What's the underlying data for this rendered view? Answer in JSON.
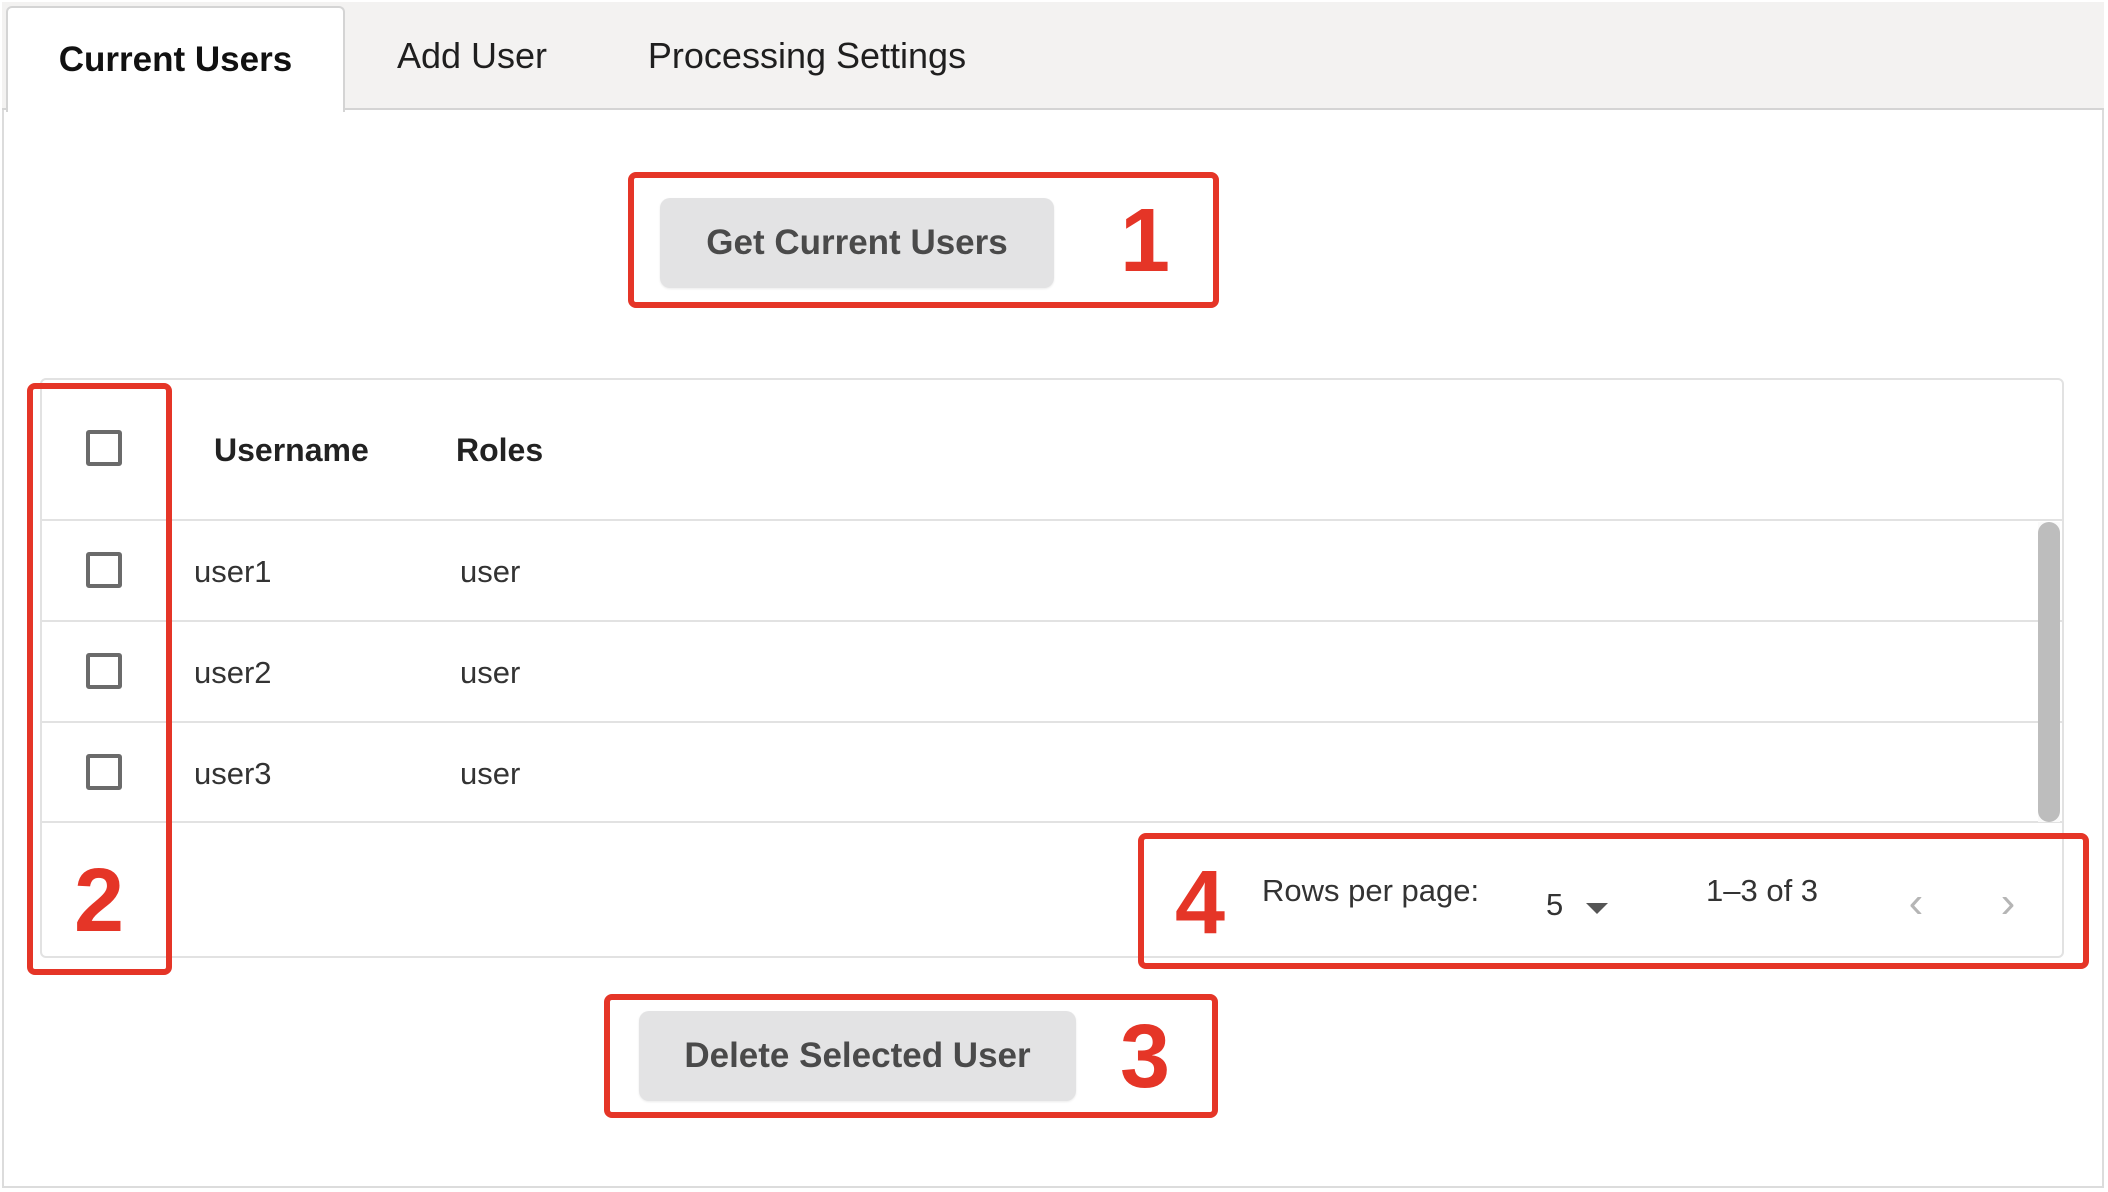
{
  "tabs": [
    {
      "label": "Current Users",
      "active": true
    },
    {
      "label": "Add User",
      "active": false
    },
    {
      "label": "Processing Settings",
      "active": false
    }
  ],
  "actions": {
    "get_users_label": "Get Current Users",
    "delete_label": "Delete Selected User"
  },
  "table": {
    "headers": {
      "username": "Username",
      "roles": "Roles"
    },
    "rows": [
      {
        "username": "user1",
        "roles": "user",
        "selected": false
      },
      {
        "username": "user2",
        "roles": "user",
        "selected": false
      },
      {
        "username": "user3",
        "roles": "user",
        "selected": false
      }
    ]
  },
  "pagination": {
    "rows_per_page_label": "Rows per page:",
    "rows_per_page_value": "5",
    "range_text": "1–3 of 3",
    "prev_icon": "chevron-left-icon",
    "next_icon": "chevron-right-icon"
  },
  "annotations": {
    "labels": [
      "1",
      "2",
      "3",
      "4"
    ],
    "color": "#e53527"
  },
  "colors": {
    "button_bg": "#e3e3e4",
    "tabbar_bg": "#f3f2f1",
    "highlight": "#e53527"
  }
}
